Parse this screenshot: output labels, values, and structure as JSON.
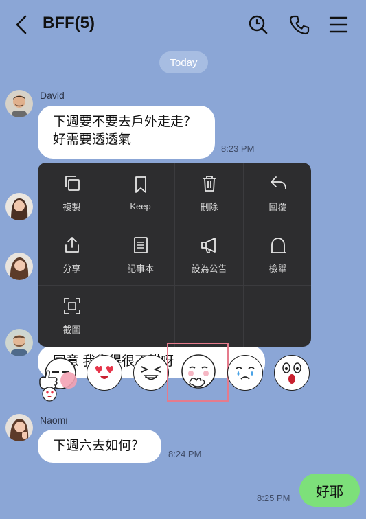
{
  "header": {
    "title": "BFF(5)",
    "icons": [
      "back-chevron-icon",
      "search-icon",
      "phone-icon",
      "menu-icon"
    ]
  },
  "date_divider": "Today",
  "messages": [
    {
      "sender": "David",
      "lines": [
        "下週要不要去戶外走走？",
        "好需要透透氣"
      ],
      "time": "8:23 PM"
    },
    {
      "sender": "",
      "partial_text": "同意 我覺得很不錯呀"
    },
    {
      "sender": "Naomi",
      "lines": [
        "下週六去如何？"
      ],
      "time": "8:24 PM"
    },
    {
      "sender": "me",
      "lines": [
        "好耶"
      ],
      "time": "8:25 PM"
    }
  ],
  "context_menu": {
    "items": [
      {
        "label": "複製",
        "icon": "copy-icon"
      },
      {
        "label": "Keep",
        "icon": "bookmark-icon"
      },
      {
        "label": "刪除",
        "icon": "trash-icon"
      },
      {
        "label": "回覆",
        "icon": "reply-icon"
      },
      {
        "label": "分享",
        "icon": "share-icon"
      },
      {
        "label": "記事本",
        "icon": "note-icon"
      },
      {
        "label": "設為公告",
        "icon": "megaphone-icon"
      },
      {
        "label": "檢舉",
        "icon": "report-icon"
      },
      {
        "label": "截圖",
        "icon": "screenshot-icon"
      }
    ]
  },
  "reactions": [
    "thumbs-up-sticker",
    "heart-eyes-sticker",
    "laughing-sticker",
    "shy-sticker",
    "crying-sticker",
    "surprised-sticker"
  ],
  "colors": {
    "background": "#8ba6d6",
    "menu": "#2d2d2f",
    "my_bubble": "#7de07a",
    "highlight": "#e57b8c"
  }
}
